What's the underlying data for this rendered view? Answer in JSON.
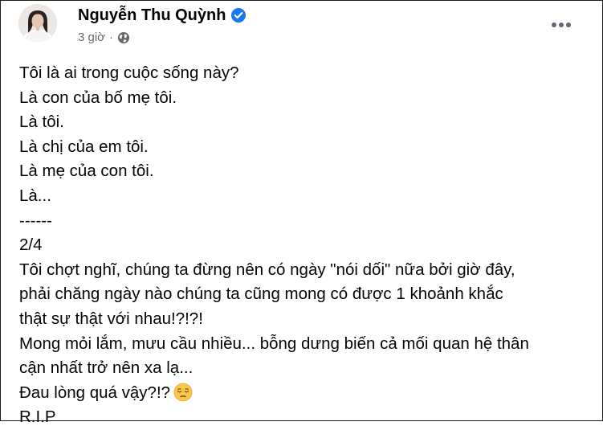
{
  "post": {
    "author": {
      "name": "Nguyễn Thu Quỳnh",
      "verified_icon": "verified-badge-icon",
      "badge_color": "#1877f2"
    },
    "time": "3 giờ",
    "separator": "·",
    "privacy_icon": "globe-icon",
    "more_icon": "more-options-icon",
    "lines": [
      "Tôi là ai trong cuộc sống này?",
      "Là con của bố mẹ tôi.",
      "Là tôi.",
      "Là chị của em tôi.",
      "Là mẹ của con tôi.",
      "Là...",
      "------",
      "2/4",
      "Tôi chợt nghĩ, chúng ta đừng nên có ngày \"nói dối\" nữa bởi giờ đây,",
      "phải chăng ngày nào chúng ta cũng mong có được 1 khoảnh khắc",
      "thật sự thật với nhau!?!?!",
      "Mong mỏi lắm, mưu cầu nhiều... bỗng dưng biến cả mối quan hệ thân",
      "cận nhất trở nên xa lạ...",
      "Đau lòng quá vậy?!?",
      "R.I.P"
    ],
    "emoji_icon": "pensive-face-emoji"
  },
  "colors": {
    "text_primary": "#050505",
    "text_secondary": "#65676b",
    "verified_blue": "#1877f2"
  }
}
